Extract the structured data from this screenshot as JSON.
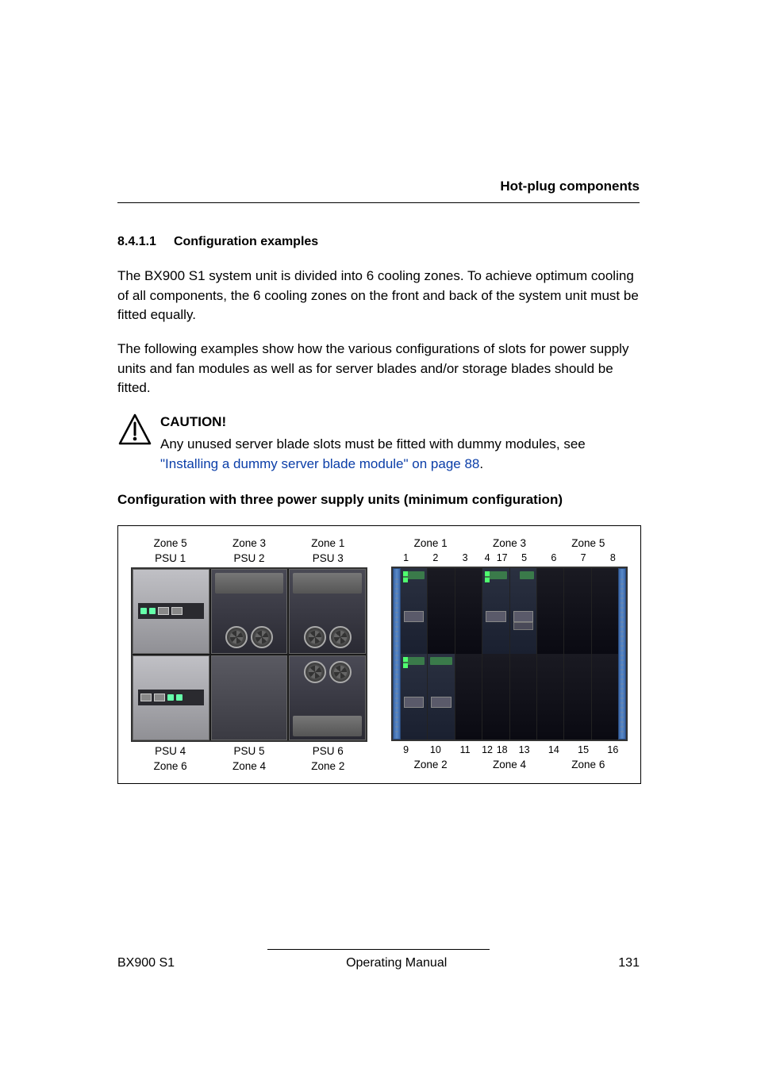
{
  "header": {
    "section": "Hot-plug components"
  },
  "section": {
    "number": "8.4.1.1",
    "title": "Configuration examples"
  },
  "paragraphs": {
    "p1": "The BX900 S1 system unit is divided into 6 cooling zones. To achieve optimum cooling of all components, the 6 cooling zones on the front and back of the system unit must be fitted equally.",
    "p2": "The following examples show how the various configurations of slots for power supply units and fan modules as well as for server blades and/or storage blades should be fitted."
  },
  "caution": {
    "label": "CAUTION!",
    "text_before_link": "Any unused server blade slots must be fitted with dummy modules, see ",
    "link": "\"Installing a dummy server blade module\" on page 88",
    "text_after_link": "."
  },
  "subheading": "Configuration with three power supply units (minimum configuration)",
  "diagram": {
    "rear": {
      "top_zones": [
        "Zone 5",
        "Zone 3",
        "Zone 1"
      ],
      "top_psus": [
        "PSU 1",
        "PSU 2",
        "PSU 3"
      ],
      "bottom_psus": [
        "PSU 4",
        "PSU 5",
        "PSU 6"
      ],
      "bottom_zones": [
        "Zone 6",
        "Zone 4",
        "Zone 2"
      ]
    },
    "front": {
      "top_zones": [
        "Zone 1",
        "Zone 3",
        "Zone 5"
      ],
      "top_slots": [
        "1",
        "2",
        "3",
        "4",
        "17",
        "5",
        "6",
        "7",
        "8"
      ],
      "bottom_slots": [
        "9",
        "10",
        "11",
        "12",
        "18",
        "13",
        "14",
        "15",
        "16"
      ],
      "bottom_zones": [
        "Zone 2",
        "Zone 4",
        "Zone 6"
      ]
    }
  },
  "chart_data": {
    "type": "table",
    "title": "Configuration with three power supply units (minimum configuration)",
    "rear_psu_layout": {
      "columns": [
        "Zone 5",
        "Zone 3",
        "Zone 1"
      ],
      "top_row": [
        {
          "slot": "PSU 1",
          "fitted": false,
          "type": "empty"
        },
        {
          "slot": "PSU 2",
          "fitted": true,
          "type": "psu_with_fans"
        },
        {
          "slot": "PSU 3",
          "fitted": true,
          "type": "psu_with_fans"
        }
      ],
      "bottom_row_columns": [
        "Zone 6",
        "Zone 4",
        "Zone 2"
      ],
      "bottom_row": [
        {
          "slot": "PSU 4",
          "fitted": false,
          "type": "empty"
        },
        {
          "slot": "PSU 5",
          "fitted": false,
          "type": "mid_module"
        },
        {
          "slot": "PSU 6",
          "fitted": true,
          "type": "psu_with_fans"
        }
      ]
    },
    "front_blade_layout": {
      "top_zones": [
        "Zone 1",
        "Zone 3",
        "Zone 5"
      ],
      "top_row_slots": [
        1,
        2,
        3,
        4,
        17,
        5,
        6,
        7,
        8
      ],
      "top_row_populated": [
        true,
        false,
        false,
        true,
        true,
        true,
        false,
        false,
        false
      ],
      "bottom_zones": [
        "Zone 2",
        "Zone 4",
        "Zone 6"
      ],
      "bottom_row_slots": [
        9,
        10,
        11,
        12,
        18,
        13,
        14,
        15,
        16
      ],
      "bottom_row_populated": [
        true,
        true,
        false,
        false,
        false,
        false,
        false,
        false,
        false
      ]
    }
  },
  "footer": {
    "left": "BX900 S1",
    "center": "Operating Manual",
    "right": "131"
  }
}
